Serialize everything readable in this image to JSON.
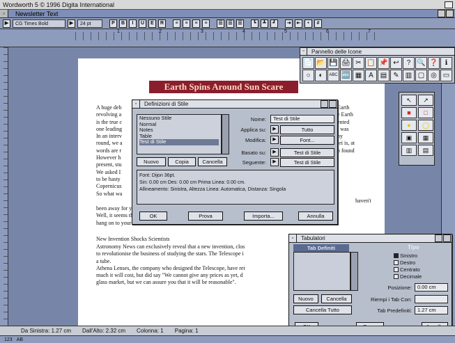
{
  "app": {
    "title": "Wordworth 5 © 1996 Digita International"
  },
  "document": {
    "title": "Newsletter Text"
  },
  "toolbar": {
    "font": "CG Times Bold",
    "size": "24 pt",
    "style_buttons": [
      "P",
      "B",
      "I",
      "U",
      "E",
      "R"
    ]
  },
  "ruler": {
    "numbers": [
      "1",
      "2",
      "3",
      "4",
      "5",
      "6",
      "7"
    ]
  },
  "page": {
    "headline": "Earth Spins Around Sun Scare",
    "para1": [
      "A huge deb",
      "revolving a",
      "is the true c",
      "one leading",
      "In an interv",
      "round, we a",
      "words are r",
      "However h",
      "present, stu",
      "We asked I",
      "to be hasty",
      "Copernicus",
      "So what wa"
    ],
    "para1_right": [
      "Earth",
      "e Earth",
      "ented",
      "",
      "",
      "t was",
      "ny",
      "",
      "lei is, at",
      "",
      "n found"
    ],
    "para1_end": [
      "been away for years, it's time I went to see some of my friends around the world.\"",
      "Well, it seems that, in his mind anyway, we might actually be spinning",
      "hang on to your hats!"
    ],
    "subhead": "New Invention Shocks Scientists",
    "para2": [
      "Astronomy News can exclusively reveal that a new invention, clos",
      "to revolutionise the business of studying the stars. The Telescope i",
      "a tube.",
      "Athena Lenses, the company who designed the Telescope, have ret",
      "much it will cost, but did say \"We cannot give any prices as yet, d",
      "glass market, but we can assure you that it will be reasonable\"."
    ],
    "haven_fragment": "haven't"
  },
  "palette": {
    "title": "Pannello delle Icone",
    "icons": [
      "📄",
      "📂",
      "💾",
      "🖨",
      "✂",
      "📋",
      "📌",
      "↩",
      "?",
      "🔍",
      "❓",
      "ℹ",
      "○",
      "◐",
      "ABC",
      "🔤",
      "▦",
      "A",
      "▤",
      "✎",
      "▥",
      "▢",
      "◎",
      "▭"
    ]
  },
  "toolstrip": {
    "icons": [
      "↖",
      "↗",
      "■",
      "□",
      "●",
      "◯",
      "▣",
      "▦",
      "▥",
      "▤"
    ]
  },
  "style_dialog": {
    "title": "Definizioni di Stile",
    "styles": [
      "Nessuno Stile",
      "Normal",
      "Notes",
      "Table",
      "Test di Stile"
    ],
    "selected_index": 4,
    "buttons": {
      "new": "Nuovo",
      "copy": "Copia",
      "delete": "Cancella"
    },
    "fields": {
      "name_label": "Nome:",
      "name_value": "Test di Stile",
      "apply_label": "Applica su:",
      "apply_value": "Tutto",
      "modify_label": "Modifica:",
      "modify_value": "Font...",
      "based_label": "Basato su:",
      "based_value": "Test di Stile",
      "next_label": "Seguente:",
      "next_value": "Test di Stile"
    },
    "info": [
      "Font: Dijon 36pt.",
      "Sin: 0.00 cm  Des: 0.00 cm  Prima Linea: 0.00 cm.",
      "Allineamento: Sinistra, Altezza Linea: Automatica, Distanza: Singola"
    ],
    "bottom": {
      "ok": "OK",
      "try": "Prova",
      "import": "Importa...",
      "cancel": "Annulla"
    }
  },
  "tab_dialog": {
    "title": "Tabulatori",
    "tab_heading": "Tab Definiti",
    "type_heading": "Tipo",
    "types": [
      "Sinistro",
      "Destro",
      "Centrato",
      "Decimale"
    ],
    "selected_type": 0,
    "position_label": "Posizione:",
    "position_value": "0.00 cm",
    "fill_label": "Riempi i Tab Con:",
    "fill_value": "",
    "default_label": "Tab Predefiniti:",
    "default_value": "1.27 cm",
    "buttons": {
      "new": "Nuovo",
      "delete": "Cancella",
      "delete_all": "Cancella Tutto",
      "ok": "OK",
      "try": "Prova",
      "cancel": "Annulla"
    }
  },
  "status": {
    "left": "Da Sinistra: 1.27 cm",
    "top": "Dall'Alto: 2.32 cm",
    "column": "Colonna: 1",
    "page": "Pagina: 1"
  },
  "bottombar": {
    "items": [
      "123",
      "AB"
    ]
  }
}
